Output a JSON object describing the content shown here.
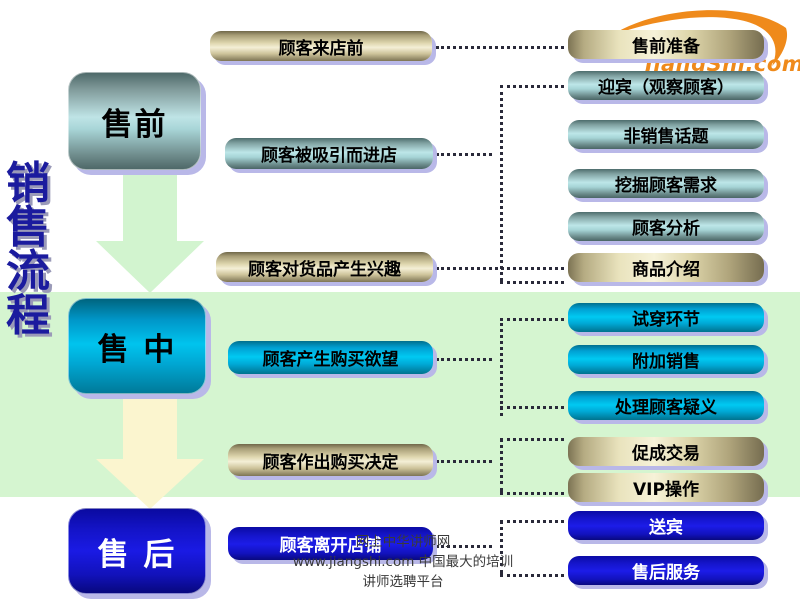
{
  "title": {
    "vertical_label": "销售流程",
    "chars": [
      "销",
      "售",
      "流",
      "程"
    ]
  },
  "logo": {
    "text": "JiangShi.com",
    "swoosh_color": "#ef8a1b",
    "text_color": "#ef8a1b"
  },
  "stages": [
    {
      "id": "pre",
      "label": "售前",
      "style": "teal-gradient",
      "text_color": "#000000"
    },
    {
      "id": "mid",
      "label": "售 中",
      "style": "cyan-gradient",
      "text_color": "#000000"
    },
    {
      "id": "post",
      "label": "售 后",
      "style": "blue-gradient",
      "text_color": "#ffffff"
    }
  ],
  "arrows": [
    {
      "id": "arrow-pre-to-mid",
      "color": "#d2f4cf"
    },
    {
      "id": "arrow-mid-to-post",
      "color": "#fbf5cf"
    }
  ],
  "middle_steps": [
    {
      "id": "m1",
      "label": "顾客来店前",
      "style": "gold"
    },
    {
      "id": "m2",
      "label": "顾客被吸引而进店",
      "style": "teal"
    },
    {
      "id": "m3",
      "label": "顾客对货品产生兴趣",
      "style": "gold"
    },
    {
      "id": "m4",
      "label": "顾客产生购买欲望",
      "style": "cyan"
    },
    {
      "id": "m5",
      "label": "顾客作出购买决定",
      "style": "gold"
    },
    {
      "id": "m6",
      "label": "顾客离开店铺",
      "style": "blue"
    }
  ],
  "right_steps": [
    {
      "id": "r1",
      "label": "售前准备",
      "style": "gold"
    },
    {
      "id": "r2",
      "label": "迎宾（观察顾客）",
      "style": "teal"
    },
    {
      "id": "r3",
      "label": "非销售话题",
      "style": "teal"
    },
    {
      "id": "r4",
      "label": "挖掘顾客需求",
      "style": "teal"
    },
    {
      "id": "r5",
      "label": "顾客分析",
      "style": "teal"
    },
    {
      "id": "r6",
      "label": "商品介绍",
      "style": "gold"
    },
    {
      "id": "r7",
      "label": "试穿环节",
      "style": "cyan"
    },
    {
      "id": "r8",
      "label": "附加销售",
      "style": "cyan"
    },
    {
      "id": "r9",
      "label": "处理顾客疑义",
      "style": "cyan"
    },
    {
      "id": "r10",
      "label": "促成交易",
      "style": "gold"
    },
    {
      "id": "r11",
      "label": "VIP操作",
      "style": "gold"
    },
    {
      "id": "r12",
      "label": "送宾",
      "style": "blue"
    },
    {
      "id": "r13",
      "label": "售后服务",
      "style": "blue"
    }
  ],
  "watermark": {
    "line1": "网上中华讲师网",
    "line2": "www.jiangshi.com 中国最大的培训",
    "line3": "讲师选聘平台"
  },
  "background": {
    "page": "#ffffff",
    "band_color": "#d5f5d0",
    "connector_color": "#2a2a3a",
    "shadow_color": "#b9b8e8"
  }
}
